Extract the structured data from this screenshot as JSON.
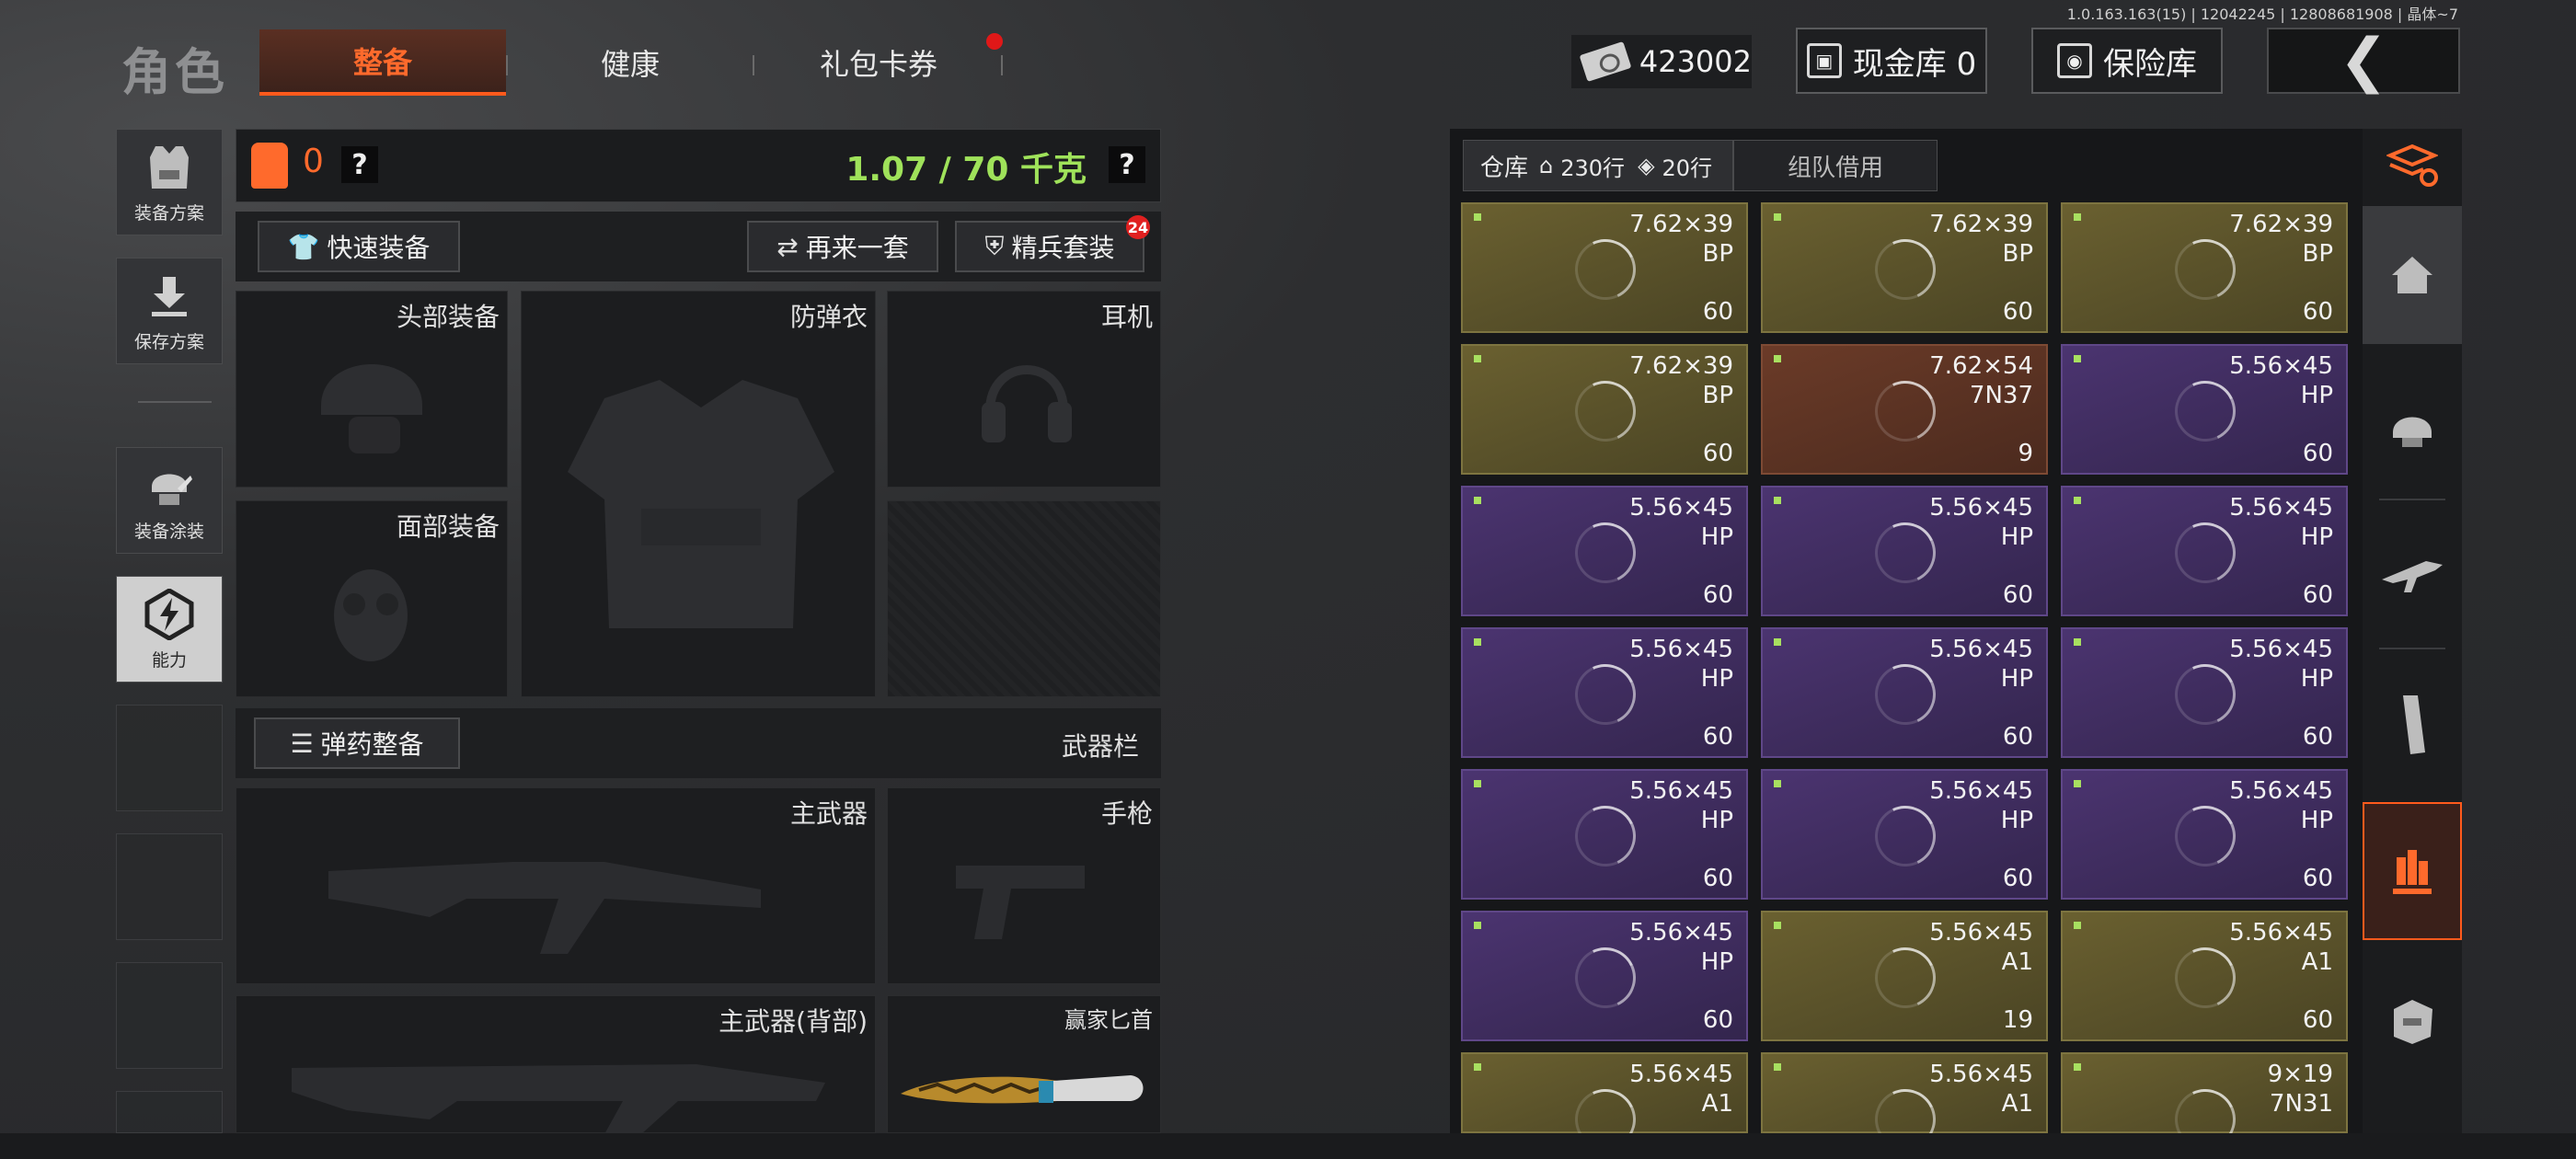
{
  "version": "1.0.163.163(15) | 12042245 | 12808681908 | 晶体~7",
  "header": {
    "title": "角色",
    "tabs": [
      {
        "label": "整备",
        "active": true
      },
      {
        "label": "健康",
        "active": false
      },
      {
        "label": "礼包卡券",
        "active": false,
        "notification": true
      }
    ],
    "money": "423002",
    "cash_vault_label": "现金库 0",
    "safe_label": "保险库"
  },
  "sidebar": {
    "items": [
      {
        "label": "装备方案",
        "icon": "vest-icon"
      },
      {
        "label": "保存方案",
        "icon": "download-icon"
      },
      {
        "label": "装备涂装",
        "icon": "helmet-paint-icon"
      },
      {
        "label": "能力",
        "icon": "lightning-icon"
      }
    ]
  },
  "equipment": {
    "armor_count": "0",
    "weight": "1.07 / 70 千克",
    "quick_equip": "快速装备",
    "repeat_set": "再来一套",
    "elite_set": "精兵套装",
    "elite_badge": "24",
    "slots": {
      "head": "头部装备",
      "body": "防弹衣",
      "ear": "耳机",
      "face": "面部装备",
      "primary": "主武器",
      "pistol": "手枪",
      "primary_back": "主武器(背部)",
      "melee": "赢家匕首"
    },
    "ammo_equip": "弹药整备",
    "weapon_bar": "武器栏"
  },
  "stash": {
    "tab_label": "仓库",
    "rows_home": "230行",
    "rows_ticket": "20行",
    "team_tab": "组队借用",
    "items": [
      {
        "cal": "7.62×39",
        "type": "BP",
        "qty": "60",
        "rarity": "gold"
      },
      {
        "cal": "7.62×39",
        "type": "BP",
        "qty": "60",
        "rarity": "gold"
      },
      {
        "cal": "7.62×39",
        "type": "BP",
        "qty": "60",
        "rarity": "gold"
      },
      {
        "cal": "7.62×39",
        "type": "BP",
        "qty": "60",
        "rarity": "gold"
      },
      {
        "cal": "7.62×54",
        "type": "7N37",
        "qty": "9",
        "rarity": "red"
      },
      {
        "cal": "5.56×45",
        "type": "HP",
        "qty": "60",
        "rarity": "purple"
      },
      {
        "cal": "5.56×45",
        "type": "HP",
        "qty": "60",
        "rarity": "purple"
      },
      {
        "cal": "5.56×45",
        "type": "HP",
        "qty": "60",
        "rarity": "purple"
      },
      {
        "cal": "5.56×45",
        "type": "HP",
        "qty": "60",
        "rarity": "purple"
      },
      {
        "cal": "5.56×45",
        "type": "HP",
        "qty": "60",
        "rarity": "purple"
      },
      {
        "cal": "5.56×45",
        "type": "HP",
        "qty": "60",
        "rarity": "purple"
      },
      {
        "cal": "5.56×45",
        "type": "HP",
        "qty": "60",
        "rarity": "purple"
      },
      {
        "cal": "5.56×45",
        "type": "HP",
        "qty": "60",
        "rarity": "purple"
      },
      {
        "cal": "5.56×45",
        "type": "HP",
        "qty": "60",
        "rarity": "purple"
      },
      {
        "cal": "5.56×45",
        "type": "HP",
        "qty": "60",
        "rarity": "purple"
      },
      {
        "cal": "5.56×45",
        "type": "HP",
        "qty": "60",
        "rarity": "purple"
      },
      {
        "cal": "5.56×45",
        "type": "A1",
        "qty": "19",
        "rarity": "gold"
      },
      {
        "cal": "5.56×45",
        "type": "A1",
        "qty": "60",
        "rarity": "gold"
      },
      {
        "cal": "5.56×45",
        "type": "A1",
        "qty": "",
        "rarity": "gold"
      },
      {
        "cal": "5.56×45",
        "type": "A1",
        "qty": "",
        "rarity": "gold"
      },
      {
        "cal": "9×19",
        "type": "7N31",
        "qty": "",
        "rarity": "gold"
      }
    ]
  },
  "rail": {
    "icons": [
      "stack-refresh-icon",
      "home-icon",
      "helmet-icon",
      "rifle-icon",
      "magazine-icon",
      "ammo-icon",
      "armor-icon"
    ]
  },
  "colors": {
    "accent": "#ff6a2c",
    "weight_ok": "#9fe25a",
    "gold": "#6a6030",
    "purple": "#4b3470",
    "red": "#6b3b28"
  }
}
